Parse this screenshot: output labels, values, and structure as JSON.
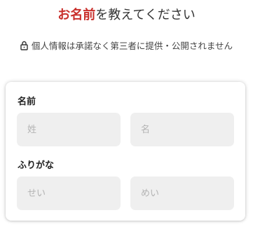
{
  "header": {
    "title_accent": "お名前",
    "title_rest": "を教えてください"
  },
  "privacy": {
    "icon": "lock-icon",
    "text": "個人情報は承諾なく第三者に提供・公開されません"
  },
  "form": {
    "name": {
      "label": "名前",
      "last_name_placeholder": "姓",
      "first_name_placeholder": "名"
    },
    "furigana": {
      "label": "ふりがな",
      "last_name_placeholder": "せい",
      "first_name_placeholder": "めい"
    }
  },
  "colors": {
    "accent": "#c9302c",
    "input_bg": "#efefef"
  }
}
